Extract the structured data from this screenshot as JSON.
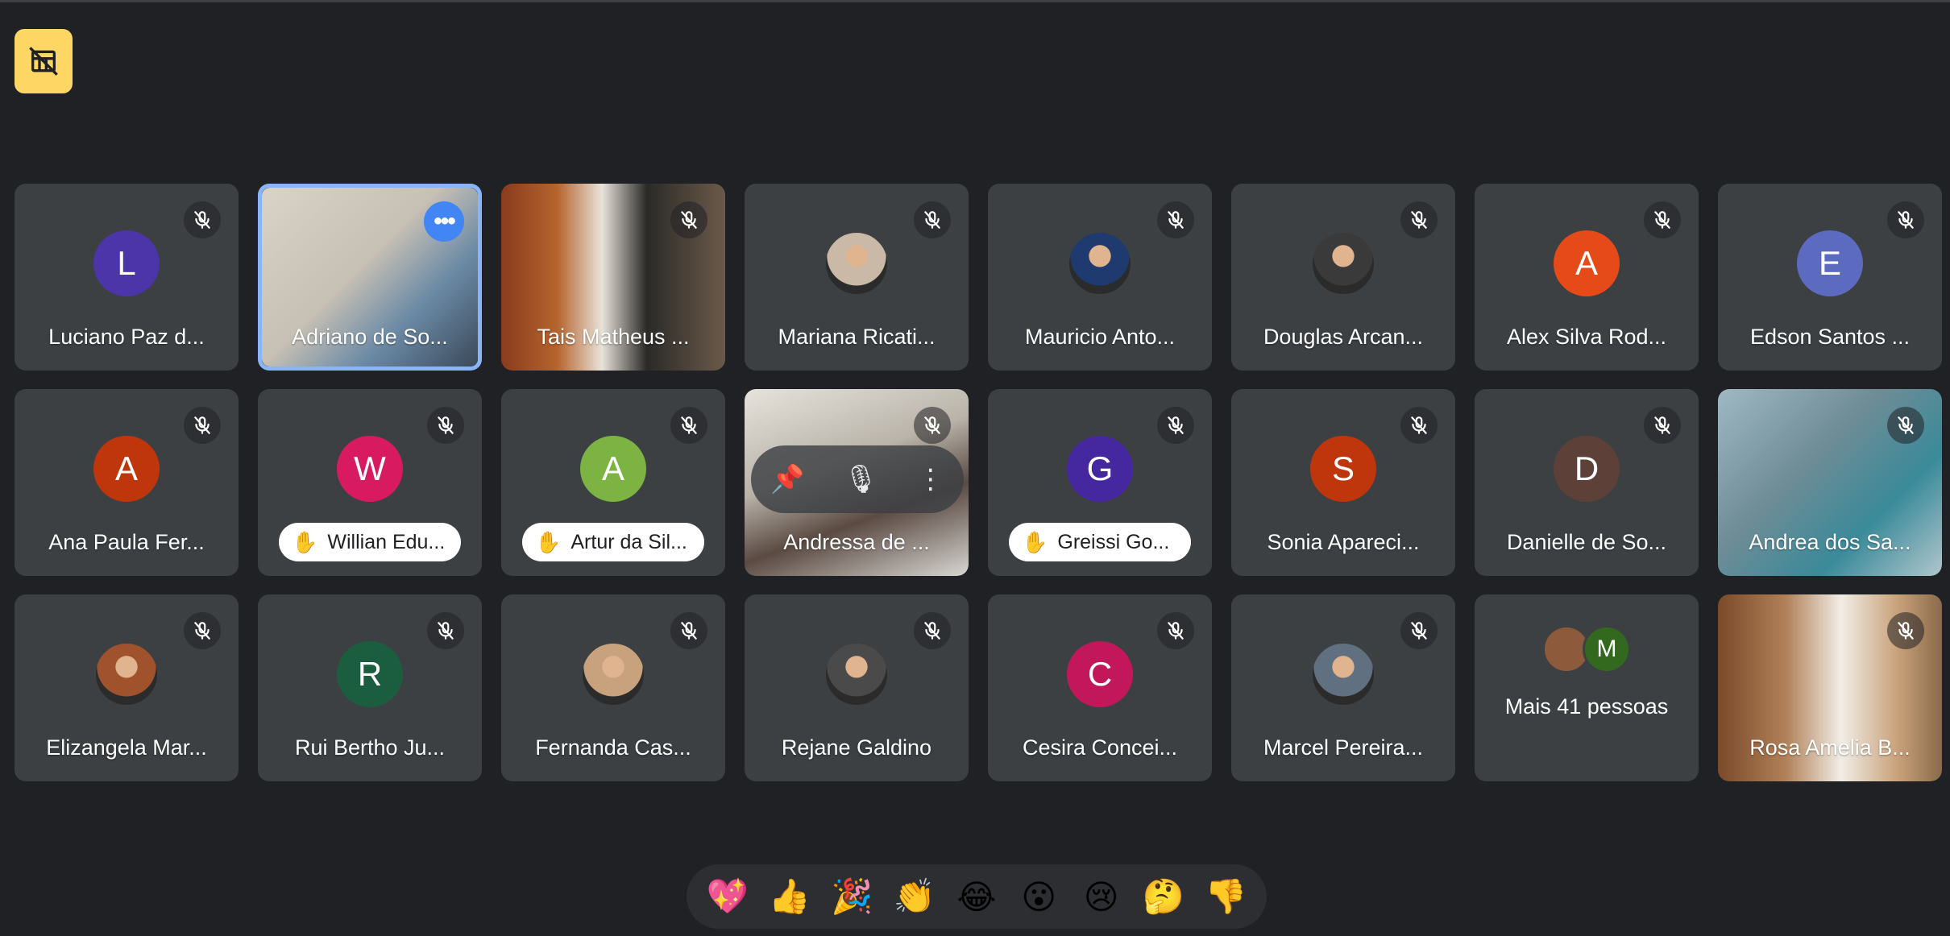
{
  "toolbar": {
    "layout_icon": "hide-tiles-icon",
    "accent": "#fdd663"
  },
  "participants": [
    {
      "name": "Luciano Paz d...",
      "initial": "L",
      "color": "#4b35a8",
      "kind": "avatar"
    },
    {
      "name": "Adriano de So...",
      "kind": "video",
      "selected": true
    },
    {
      "name": "Tais Matheus ...",
      "kind": "video"
    },
    {
      "name": "Mariana Ricati...",
      "kind": "photo",
      "color": "#c9b9a6"
    },
    {
      "name": "Mauricio Anto...",
      "kind": "photo",
      "color": "#1e3a6e"
    },
    {
      "name": "Douglas Arcan...",
      "kind": "photo",
      "color": "#3a3a3a"
    },
    {
      "name": "Alex Silva Rod...",
      "initial": "A",
      "color": "#e64a19",
      "kind": "avatar"
    },
    {
      "name": "Edson Santos ...",
      "initial": "E",
      "color": "#5c6bc0",
      "kind": "avatar"
    },
    {
      "name": "Ana Paula Fer...",
      "initial": "A",
      "color": "#bf360c",
      "kind": "avatar"
    },
    {
      "name": "Willian Edu...",
      "initial": "W",
      "color": "#d81b60",
      "kind": "avatar",
      "hand": true
    },
    {
      "name": "Artur da Sil...",
      "initial": "A",
      "color": "#7cb342",
      "kind": "avatar",
      "hand": true
    },
    {
      "name": "Andressa de ...",
      "kind": "video",
      "hover": true
    },
    {
      "name": "Greissi Go...",
      "initial": "G",
      "color": "#4527a0",
      "kind": "avatar",
      "hand": true
    },
    {
      "name": "Sonia Apareci...",
      "initial": "S",
      "color": "#bf360c",
      "kind": "avatar"
    },
    {
      "name": "Danielle de So...",
      "initial": "D",
      "color": "#5d4037",
      "kind": "avatar"
    },
    {
      "name": "Andrea dos Sa...",
      "kind": "video"
    },
    {
      "name": "Elizangela Mar...",
      "kind": "photo",
      "color": "#a0522d"
    },
    {
      "name": "Rui Bertho Ju...",
      "initial": "R",
      "color": "#1b5e3f",
      "kind": "avatar"
    },
    {
      "name": "Fernanda Cas...",
      "kind": "photo",
      "color": "#c8a27c"
    },
    {
      "name": "Rejane Galdino",
      "kind": "photo",
      "color": "#4a4a4a"
    },
    {
      "name": "Cesira Concei...",
      "initial": "C",
      "color": "#c2185b",
      "kind": "avatar"
    },
    {
      "name": "Marcel Pereira...",
      "kind": "photo",
      "color": "#607080"
    },
    {
      "label": "Mais 41 pessoas",
      "kind": "more",
      "mini": [
        {
          "initial": "",
          "color": "#8d5a3b"
        },
        {
          "initial": "M",
          "color": "#33691e"
        }
      ]
    },
    {
      "name": "Rosa Amelia B...",
      "kind": "video"
    }
  ],
  "hover_controls": {
    "pin": "📌",
    "mute": "🎙",
    "more": "⋮"
  },
  "hand_icon": "✋",
  "reactions": [
    "💖",
    "👍",
    "🎉",
    "👏",
    "😂",
    "😮",
    "😢",
    "🤔",
    "👎"
  ]
}
